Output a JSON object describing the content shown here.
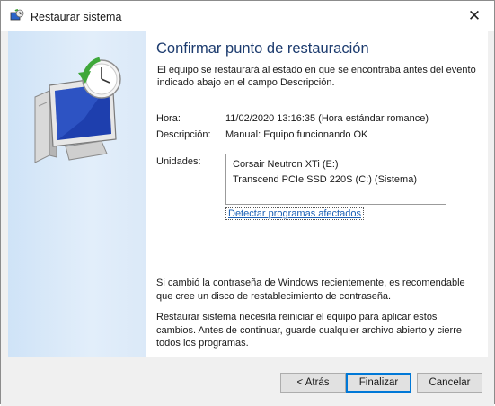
{
  "window": {
    "title": "Restaurar sistema",
    "close_glyph": "✕"
  },
  "page": {
    "heading": "Confirmar punto de restauración",
    "intro": "El equipo se restaurará al estado en que se encontraba antes del evento indicado abajo en el campo Descripción."
  },
  "details": {
    "time_label": "Hora:",
    "time_value": "11/02/2020 13:16:35 (Hora estándar romance)",
    "description_label": "Descripción:",
    "description_value": "Manual: Equipo funcionando OK",
    "drives_label": "Unidades:",
    "drives": [
      "Corsair Neutron XTi (E:)",
      "Transcend PCIe SSD 220S (C:) (Sistema)"
    ],
    "detect_link": "Detectar programas afectados"
  },
  "notes": {
    "password": "Si cambió la contraseña de Windows recientemente, es recomendable que cree un disco de restablecimiento de contraseña.",
    "restart": "Restaurar sistema necesita reiniciar el equipo para aplicar estos cambios. Antes de continuar, guarde cualquier archivo abierto y cierre todos los programas."
  },
  "buttons": {
    "back": "< Atrás",
    "finish": "Finalizar",
    "cancel": "Cancelar"
  },
  "icons": {
    "app": "system-restore-icon",
    "illustration": "system-restore-illustration"
  },
  "colors": {
    "heading": "#1c3b6e",
    "link": "#1a5fb4",
    "primary_border": "#0078d7"
  }
}
